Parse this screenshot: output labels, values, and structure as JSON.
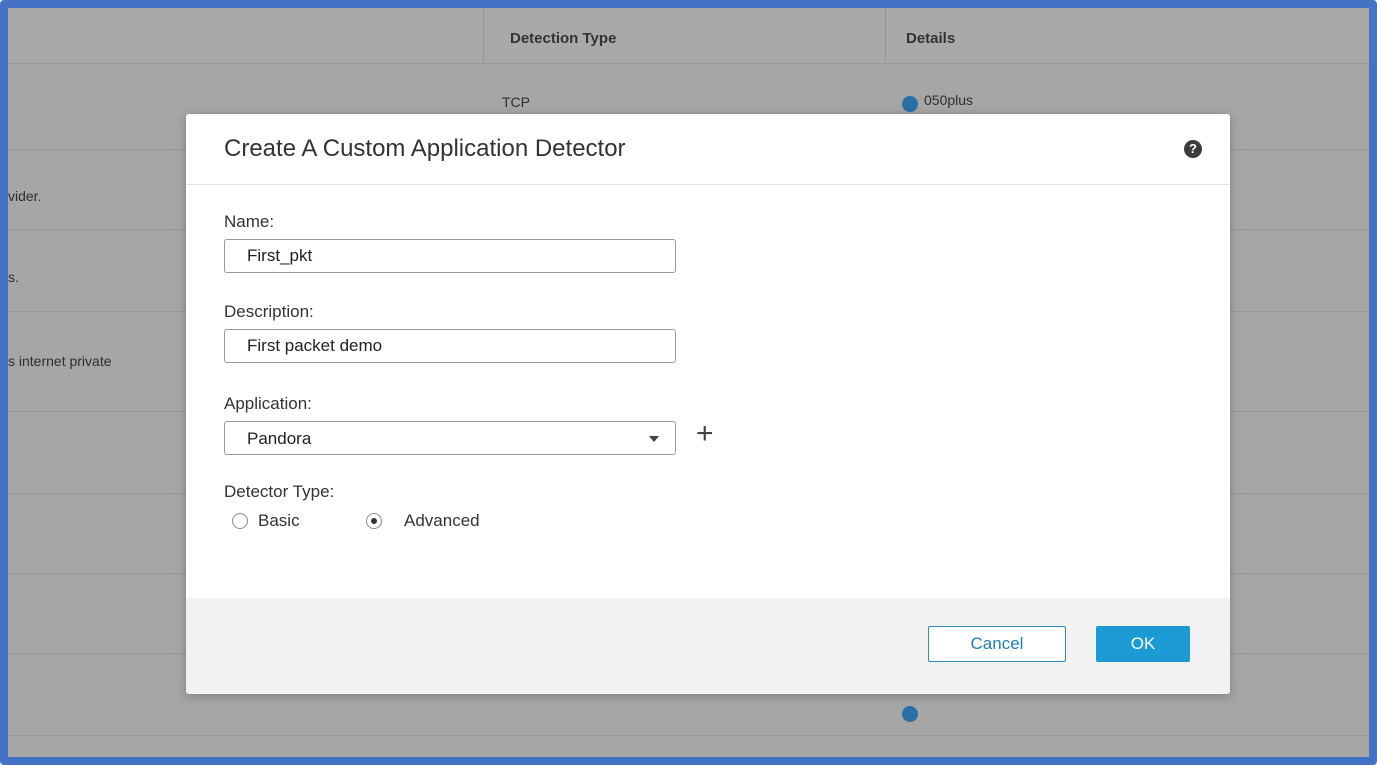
{
  "background_table": {
    "headers": {
      "detection_type": "Detection Type",
      "details": "Details"
    },
    "rows": [
      {
        "detection_type": "TCP",
        "details": "050plus",
        "desc": ""
      },
      {
        "desc": "vider."
      },
      {
        "desc": "s."
      },
      {
        "desc": "s internet private"
      }
    ]
  },
  "dialog": {
    "title": "Create A Custom Application Detector",
    "help_icon": "?",
    "name_label": "Name:",
    "name_value": "First_pkt",
    "description_label": "Description:",
    "description_value": "First packet demo",
    "application_label": "Application:",
    "application_value": "Pandora",
    "add_icon": "+",
    "detector_type_label": "Detector Type:",
    "detector_type_options": [
      "Basic",
      "Advanced"
    ],
    "detector_type_selected": "Advanced",
    "cancel_label": "Cancel",
    "ok_label": "OK"
  },
  "colors": {
    "frame": "#4472c4",
    "primary_button": "#1b9ad6",
    "overlay": "#a6a6a6"
  }
}
